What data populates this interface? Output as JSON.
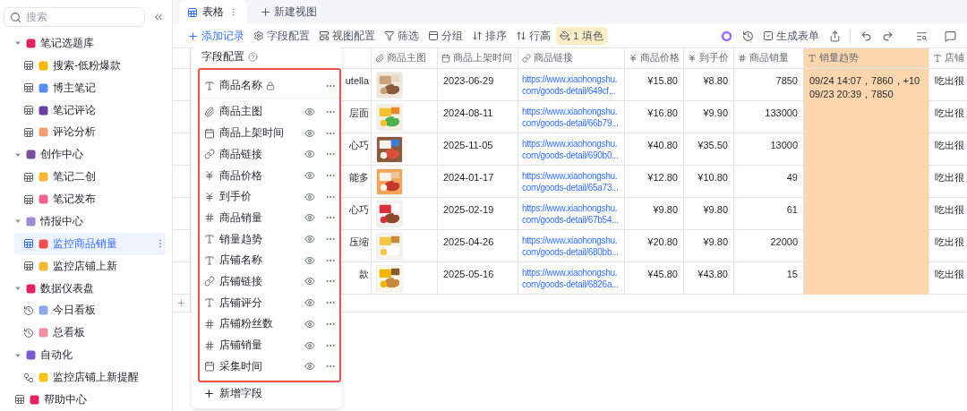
{
  "sidebar": {
    "search": {
      "placeholder": "搜索"
    },
    "items": [
      {
        "label": "笔记选题库",
        "kind": "group",
        "expanded": true,
        "children": [
          {
            "label": "搜索-低粉爆款",
            "kind": "table",
            "selected": false
          },
          {
            "label": "博主笔记",
            "kind": "table",
            "selected": false
          },
          {
            "label": "笔记评论",
            "kind": "table",
            "selected": false
          },
          {
            "label": "评论分析",
            "kind": "table",
            "selected": false
          }
        ]
      },
      {
        "label": "创作中心",
        "kind": "group",
        "expanded": true,
        "children": [
          {
            "label": "笔记二创",
            "kind": "table",
            "selected": false
          },
          {
            "label": "笔记发布",
            "kind": "table",
            "selected": false
          }
        ]
      },
      {
        "label": "情报中心",
        "kind": "group",
        "expanded": true,
        "children": [
          {
            "label": "监控商品销量",
            "kind": "table",
            "selected": true
          },
          {
            "label": "监控店铺上新",
            "kind": "table",
            "selected": false
          }
        ]
      },
      {
        "label": "数据仪表盘",
        "kind": "group",
        "expanded": true,
        "children": [
          {
            "label": "今日看板",
            "kind": "dashboard",
            "selected": false
          },
          {
            "label": "总看板",
            "kind": "dashboard",
            "selected": false
          }
        ]
      },
      {
        "label": "自动化",
        "kind": "group",
        "expanded": true,
        "children": [
          {
            "label": "监控店铺上新提醒",
            "kind": "automation",
            "selected": false
          }
        ]
      },
      {
        "label": "帮助中心",
        "kind": "table",
        "selected": false
      }
    ]
  },
  "view_tabs": [
    {
      "label": "表格",
      "selected": true
    }
  ],
  "new_view_button": "新建视图",
  "toolbar": {
    "add_record": "添加记录",
    "tools": [
      {
        "label": "字段配置",
        "kind": "fields",
        "highlighted": false
      },
      {
        "label": "视图配置",
        "kind": "view",
        "highlighted": false
      },
      {
        "label": "筛选",
        "kind": "filter",
        "highlighted": false
      },
      {
        "label": "分组",
        "kind": "group",
        "highlighted": false
      },
      {
        "label": "排序",
        "kind": "sort",
        "highlighted": false
      },
      {
        "label": "行高",
        "kind": "height",
        "highlighted": false
      },
      {
        "label": "1 填色",
        "kind": "fill",
        "highlighted": true
      }
    ],
    "generate_form": "生成表单"
  },
  "table": {
    "columns": [
      {
        "label": "商品主图",
        "kind": "attachment",
        "highlighted": false
      },
      {
        "label": "商品上架时间",
        "kind": "date",
        "highlighted": false
      },
      {
        "label": "商品链接",
        "kind": "link",
        "highlighted": false
      },
      {
        "label": "商品价格",
        "kind": "currency",
        "highlighted": false
      },
      {
        "label": "到手价",
        "kind": "currency",
        "highlighted": false
      },
      {
        "label": "商品销量",
        "kind": "number",
        "highlighted": false
      },
      {
        "label": "销量趋势",
        "kind": "text",
        "highlighted": true
      },
      {
        "label": "店铺",
        "kind": "text",
        "highlighted": false
      }
    ],
    "rows": [
      {
        "name": "utella",
        "date": "2023-06-29",
        "link": "https://www.xiaohongshu.com/goods-detail/649cf...",
        "price": "¥15.80",
        "final_price": "¥8.80",
        "sales": "7850",
        "trend": "09/24 14:07，7860，+10\n09/23 20:39，7850",
        "store": "吃出很"
      },
      {
        "name": "层面",
        "date": "2024-08-11",
        "link": "https://www.xiaohongshu.com/goods-detail/66b79...",
        "price": "¥16.80",
        "final_price": "¥9.90",
        "sales": "133000",
        "store": "吃出很"
      },
      {
        "name": "心巧",
        "date": "2025-11-05",
        "link": "https://www.xiaohongshu.com/goods-detail/690b0...",
        "price": "¥40.80",
        "final_price": "¥35.50",
        "sales": "13000",
        "store": "吃出很"
      },
      {
        "name": "能多",
        "date": "2024-01-17",
        "link": "https://www.xiaohongshu.com/goods-detail/65a73...",
        "price": "¥12.80",
        "final_price": "¥10.80",
        "sales": "49",
        "store": "吃出很"
      },
      {
        "name": "心巧",
        "date": "2025-02-19",
        "link": "https://www.xiaohongshu.com/goods-detail/67b54...",
        "price": "¥9.80",
        "final_price": "¥9.80",
        "sales": "61",
        "store": "吃出很"
      },
      {
        "name": "压缩",
        "date": "2025-04-26",
        "link": "https://www.xiaohongshu.com/goods-detail/680bb...",
        "price": "¥20.80",
        "final_price": "¥9.80",
        "sales": "22000",
        "store": "吃出很"
      },
      {
        "name": "款",
        "date": "2025-05-16",
        "link": "https://www.xiaohongshu.com/goods-detail/6826a...",
        "price": "¥45.80",
        "final_price": "¥43.80",
        "sales": "15",
        "store": "吃出很"
      }
    ]
  },
  "field_panel": {
    "title": "字段配置",
    "fields": [
      {
        "label": "商品名称",
        "kind": "text",
        "locked": true
      },
      {
        "label": "商品主图",
        "kind": "attachment",
        "locked": false
      },
      {
        "label": "商品上架时间",
        "kind": "date",
        "locked": false
      },
      {
        "label": "商品链接",
        "kind": "link",
        "locked": false
      },
      {
        "label": "商品价格",
        "kind": "currency",
        "locked": false
      },
      {
        "label": "到手价",
        "kind": "currency",
        "locked": false
      },
      {
        "label": "商品销量",
        "kind": "number",
        "locked": false
      },
      {
        "label": "销量趋势",
        "kind": "text",
        "locked": false
      },
      {
        "label": "店铺名称",
        "kind": "text",
        "locked": false
      },
      {
        "label": "店铺链接",
        "kind": "link",
        "locked": false
      },
      {
        "label": "店铺评分",
        "kind": "text",
        "locked": false
      },
      {
        "label": "店铺粉丝数",
        "kind": "number",
        "locked": false
      },
      {
        "label": "店铺销量",
        "kind": "number",
        "locked": false
      },
      {
        "label": "采集时间",
        "kind": "date",
        "locked": false
      }
    ],
    "add_field": "新增字段"
  }
}
